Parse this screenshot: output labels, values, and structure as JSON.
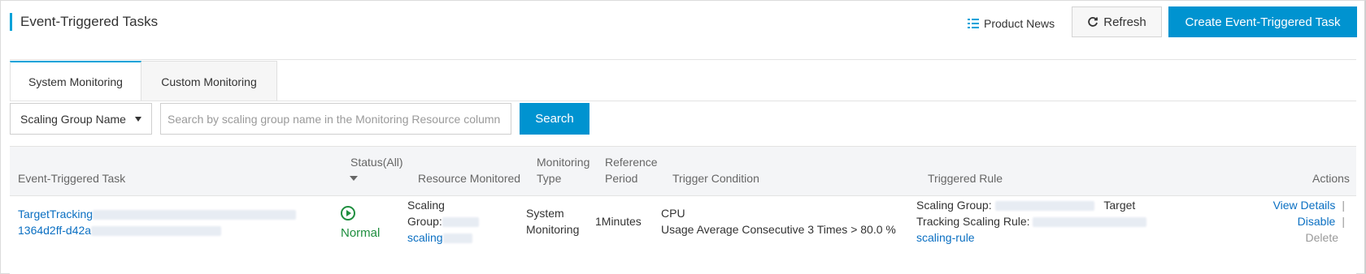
{
  "header": {
    "title": "Event-Triggered Tasks",
    "product_news": "Product News",
    "refresh": "Refresh",
    "create": "Create Event-Triggered Task"
  },
  "tabs": [
    {
      "label": "System Monitoring",
      "active": true
    },
    {
      "label": "Custom Monitoring",
      "active": false
    }
  ],
  "search": {
    "select_value": "Scaling Group Name",
    "placeholder": "Search by scaling group name in the Monitoring Resource column",
    "button": "Search"
  },
  "table": {
    "columns": {
      "task": "Event-Triggered Task",
      "status": "Status(All)",
      "resource": "Resource Monitored",
      "monitoring_type_1": "Monitoring",
      "monitoring_type_2": "Type",
      "reference_period_1": "Reference",
      "reference_period_2": "Period",
      "trigger_condition": "Trigger Condition",
      "triggered_rule": "Triggered Rule",
      "actions": "Actions"
    },
    "rows": [
      {
        "task_line1": "TargetTracking",
        "task_line2": "1364d2ff-d42a",
        "status": "Normal",
        "resource_line1": "Scaling",
        "resource_line2": "Group:",
        "resource_line3": "scaling",
        "monitoring_type_1": "System",
        "monitoring_type_2": "Monitoring",
        "reference_period": "1Minutes",
        "condition_line1": "CPU",
        "condition_line2": "Usage Average Consecutive 3 Times > 80.0 %",
        "rule_line1_label": "Scaling Group:",
        "rule_line1_suffix": "Target",
        "rule_line2_label": "Tracking Scaling Rule:",
        "rule_line3": "scaling-rule",
        "action_view": "View Details",
        "action_disable": "Disable",
        "action_delete": "Delete",
        "separator": "|"
      }
    ]
  },
  "colors": {
    "accent": "#0093d0",
    "link": "#0a6fc2",
    "status_normal": "#1e8e3e"
  }
}
